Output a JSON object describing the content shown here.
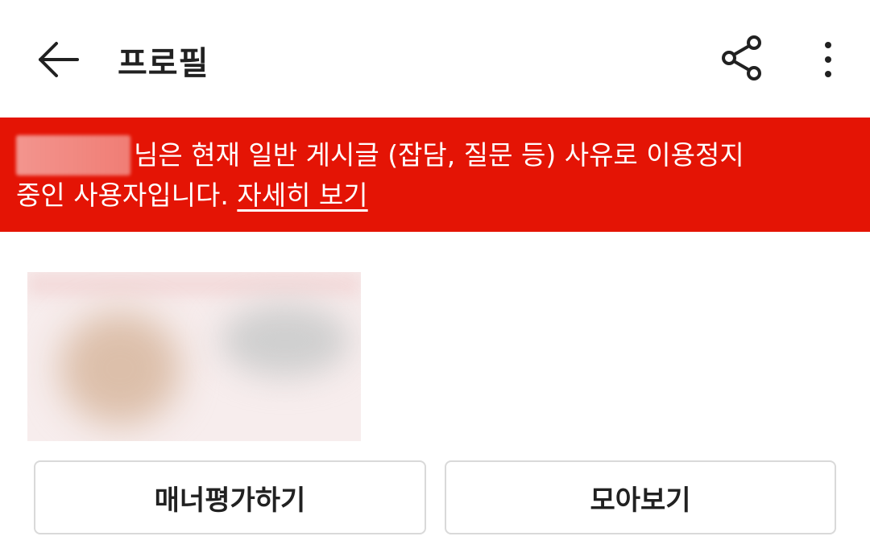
{
  "header": {
    "title": "프로필",
    "back_icon": "arrow-left-icon",
    "share_icon": "share-icon",
    "more_icon": "more-vertical-icon"
  },
  "banner": {
    "line1_text": "님은 현재 일반 게시글 (잡담, 질문 등) 사유로 이용정지",
    "line2_text": "중인 사용자입니다. ",
    "link_text": "자세히 보기",
    "background_color": "#e41405"
  },
  "actions": {
    "manner_label": "매너평가하기",
    "collect_label": "모아보기"
  }
}
